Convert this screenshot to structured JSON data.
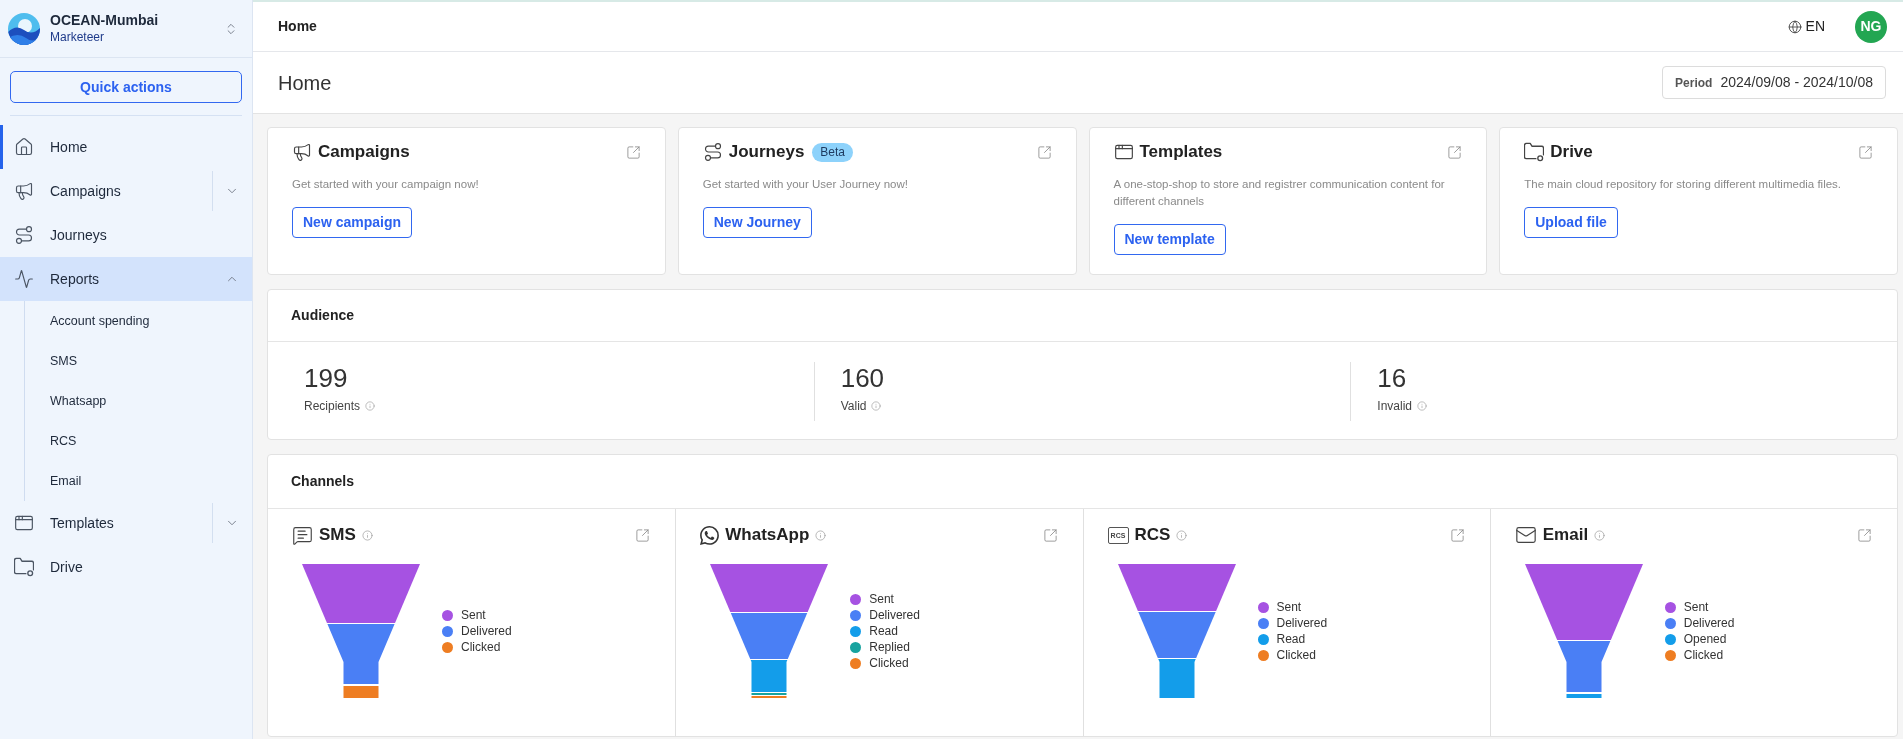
{
  "sidebar": {
    "organization": {
      "name": "OCEAN-Mumbai",
      "role": "Marketeer"
    },
    "quick_actions": "Quick actions",
    "items": [
      {
        "label": "Home",
        "selected": true
      },
      {
        "label": "Campaigns",
        "selected": false,
        "expanded": false
      },
      {
        "label": "Journeys",
        "selected": false
      },
      {
        "label": "Reports",
        "selected": false,
        "expanded": true,
        "children": [
          {
            "label": "Account spending",
            "selected": false
          },
          {
            "label": "SMS",
            "selected": false
          },
          {
            "label": "Whatsapp",
            "selected": false
          },
          {
            "label": "RCS",
            "selected": false
          },
          {
            "label": "Email",
            "selected": false
          }
        ]
      },
      {
        "label": "Templates",
        "selected": false,
        "expanded": false
      },
      {
        "label": "Drive",
        "selected": false
      }
    ]
  },
  "topbar": {
    "title": "Home",
    "language": "EN",
    "avatar": "NG"
  },
  "page_header": {
    "title": "Home",
    "period": {
      "label": "Period",
      "range": "2024/09/08 - 2024/10/08"
    }
  },
  "cards": [
    {
      "title": "Campaigns",
      "description": "Get started with your campaign now!",
      "button": "New campaign"
    },
    {
      "title": "Journeys",
      "badge": "Beta",
      "description": "Get started with your User Journey now!",
      "button": "New Journey"
    },
    {
      "title": "Templates",
      "description": "A one-stop-shop to store and registrer communication content for different channels",
      "button": "New template"
    },
    {
      "title": "Drive",
      "description": "The main cloud repository for storing different multimedia files.",
      "button": "Upload file"
    }
  ],
  "audience": {
    "title": "Audience",
    "stats": [
      {
        "value": "199",
        "label": "Recipients"
      },
      {
        "value": "160",
        "label": "Valid"
      },
      {
        "value": "16",
        "label": "Invalid"
      }
    ]
  },
  "channels": {
    "title": "Channels",
    "items": [
      {
        "name": "SMS",
        "legend": [
          {
            "label": "Sent",
            "color": "#a652e2"
          },
          {
            "label": "Delivered",
            "color": "#4a7ff5"
          },
          {
            "label": "Clicked",
            "color": "#ee7d22"
          }
        ]
      },
      {
        "name": "WhatsApp",
        "legend": [
          {
            "label": "Sent",
            "color": "#a652e2"
          },
          {
            "label": "Delivered",
            "color": "#4a7ff5"
          },
          {
            "label": "Read",
            "color": "#139dea"
          },
          {
            "label": "Replied",
            "color": "#17a39f"
          },
          {
            "label": "Clicked",
            "color": "#ee7d22"
          }
        ]
      },
      {
        "name": "RCS",
        "icon_text": "RCS",
        "legend": [
          {
            "label": "Sent",
            "color": "#a652e2"
          },
          {
            "label": "Delivered",
            "color": "#4a7ff5"
          },
          {
            "label": "Read",
            "color": "#139dea"
          },
          {
            "label": "Clicked",
            "color": "#ee7d22"
          }
        ]
      },
      {
        "name": "Email",
        "legend": [
          {
            "label": "Sent",
            "color": "#a652e2"
          },
          {
            "label": "Delivered",
            "color": "#4a7ff5"
          },
          {
            "label": "Opened",
            "color": "#139dea"
          },
          {
            "label": "Clicked",
            "color": "#ee7d22"
          }
        ]
      }
    ]
  }
}
